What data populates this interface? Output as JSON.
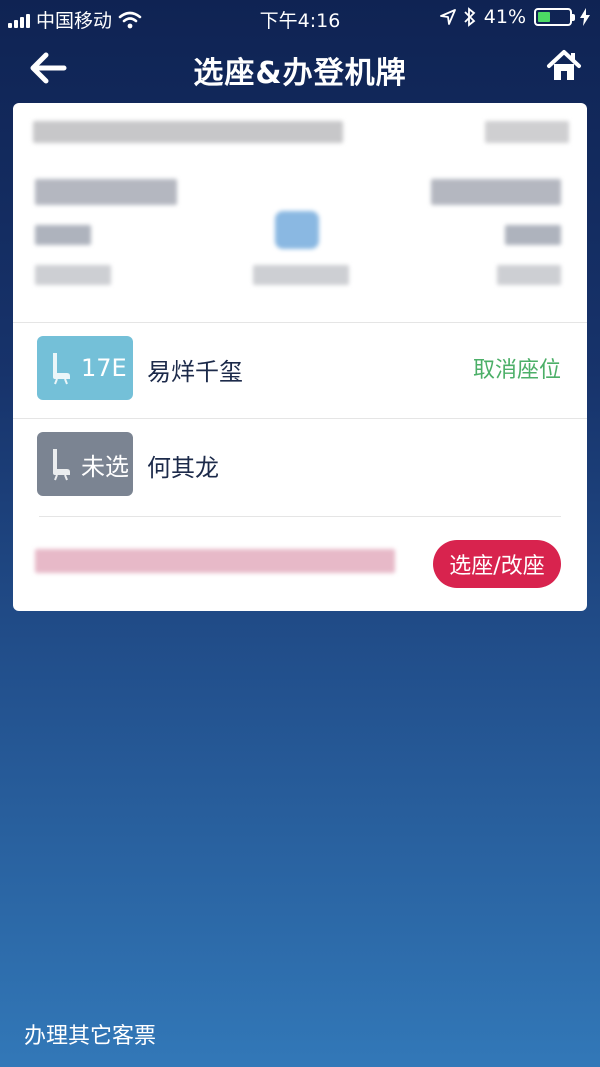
{
  "status_bar": {
    "carrier": "中国移动",
    "time": "下午4:16",
    "battery": "41%",
    "battery_level": 0.41,
    "icons": [
      "signal-icon",
      "wifi-icon",
      "location-icon",
      "bluetooth-icon",
      "battery-icon",
      "charging-icon"
    ]
  },
  "nav": {
    "title": "选座&办登机牌",
    "back_icon": "back-arrow-icon",
    "home_icon": "home-icon"
  },
  "passengers": [
    {
      "seat": "17E",
      "name": "易烊千玺",
      "action": "取消座位",
      "badge_color": "#74c0d8"
    },
    {
      "seat": "未选",
      "name": "何其龙",
      "action": "",
      "badge_color": "#7b8492"
    }
  ],
  "select_button": "选座/改座",
  "footer": {
    "other_tickets": "办理其它客票"
  },
  "colors": {
    "accent": "#d8234e",
    "cancel": "#4caf68",
    "background_top": "#0f2353",
    "background_bottom": "#3278b8"
  }
}
